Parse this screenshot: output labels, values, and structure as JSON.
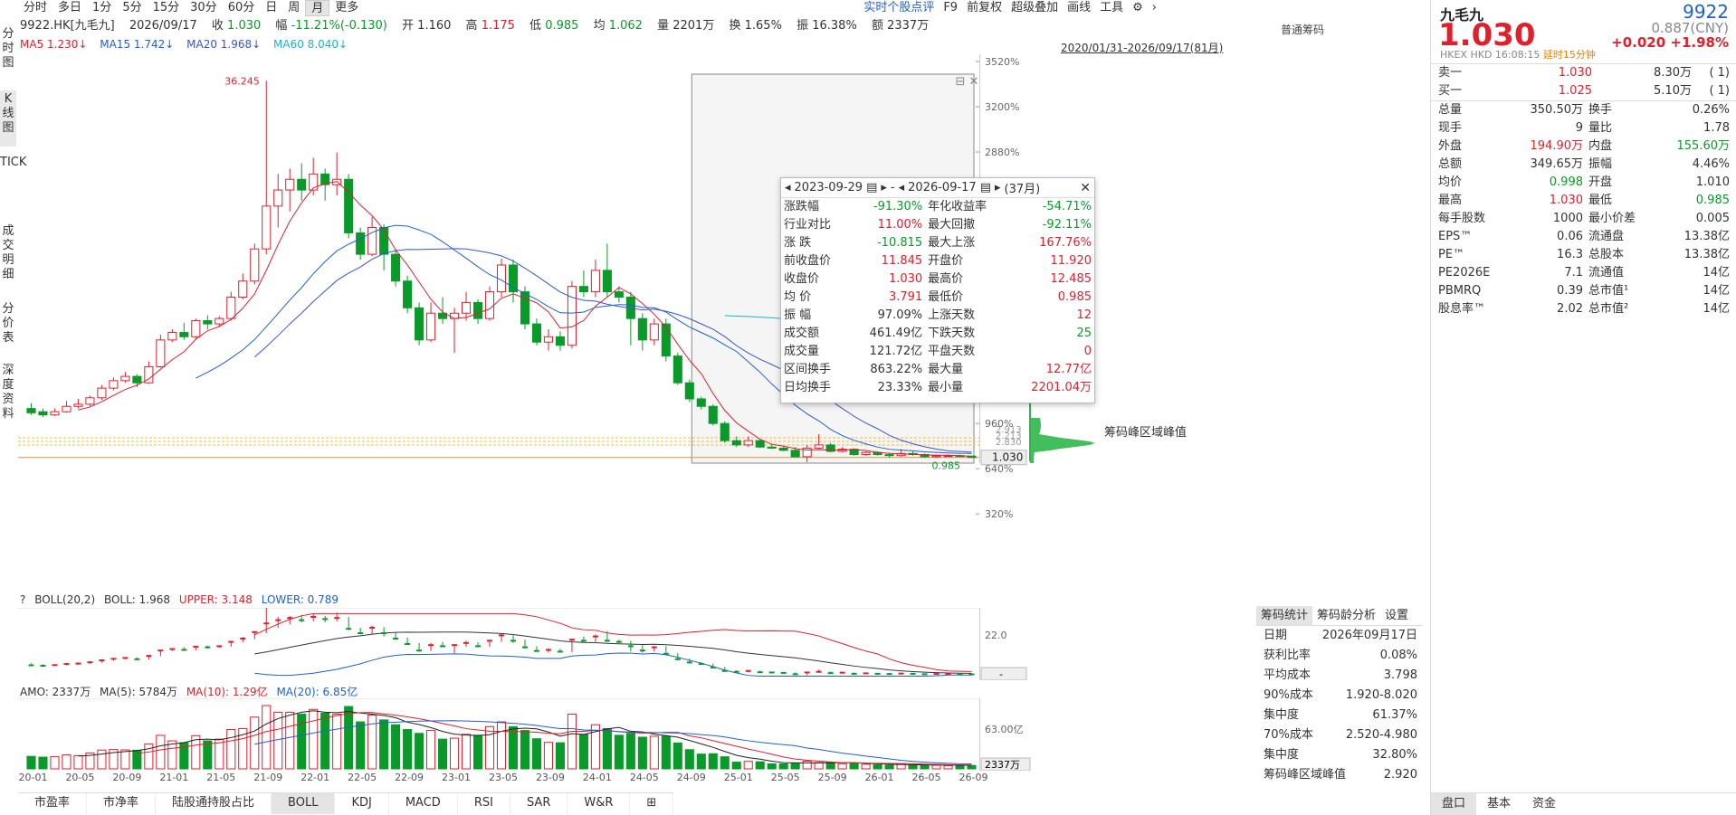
{
  "periods": [
    "分时",
    "多日",
    "1分",
    "5分",
    "15分",
    "30分",
    "60分",
    "日",
    "周",
    "月",
    "更多"
  ],
  "active_period": "月",
  "info": {
    "code": "9922.HK[九毛九]",
    "date": "2026/09/17",
    "close_label": "收",
    "close": "1.030",
    "range_label": "幅",
    "range": "-11.21%(-0.130)",
    "open_label": "开",
    "open": "1.160",
    "high_label": "高",
    "high": "1.175",
    "low_label": "低",
    "low": "0.985",
    "avg_label": "均",
    "avg": "1.062",
    "vol_label": "量",
    "vol": "2201万",
    "turn_label": "换",
    "turn": "1.65%",
    "amp_label": "振",
    "amp": "16.38%",
    "amt_label": "额",
    "amt": "2337万"
  },
  "topright": [
    "实时个股点评",
    "F9",
    "前复权",
    "超级叠加",
    "画线",
    "工具"
  ],
  "ma": {
    "ma5": "MA5 1.230↓",
    "ma15": "MA15 1.742↓",
    "ma20": "MA20 1.968↓",
    "ma60": "MA60 8.040↓"
  },
  "date_range": "2020/01/31-2026/09/17(81月)",
  "chips_title": "普通筹码",
  "sidebar": [
    "分时图",
    "K线图",
    "TICK",
    "成交明细",
    "分价表",
    "深度资料"
  ],
  "main_chart": {
    "y_ticks": [
      "3520%",
      "3200%",
      "2880%",
      "2560%",
      "2240%",
      "1920%",
      "1600%",
      "1280%",
      "960%",
      "640%",
      "320%"
    ],
    "max_label": "36.245",
    "min_label": "0.985",
    "last_price": "1.030",
    "chip_right_labels": [
      "2.913",
      "2.213",
      "2.830"
    ],
    "chip_label": "筹码峰区域峰值"
  },
  "popup": {
    "start": "2023-09-29",
    "sep": "-",
    "end": "2026-09-17",
    "months": "(37月)",
    "rows": [
      [
        "涨跌幅",
        "-91.30%",
        "年化收益率",
        "-54.71%"
      ],
      [
        "行业对比",
        "11.00%",
        "最大回撤",
        "-92.11%"
      ],
      [
        "涨 跌",
        "-10.815",
        "最大上涨",
        "167.76%"
      ],
      [
        "前收盘价",
        "11.845",
        "开盘价",
        "11.920"
      ],
      [
        "收盘价",
        "1.030",
        "最高价",
        "12.485"
      ],
      [
        "均 价",
        "3.791",
        "最低价",
        "0.985"
      ],
      [
        "振 幅",
        "97.09%",
        "上涨天数",
        "12"
      ],
      [
        "成交额",
        "461.49亿",
        "下跌天数",
        "25"
      ],
      [
        "成交量",
        "121.72亿",
        "平盘天数",
        "0"
      ],
      [
        "区间换手",
        "863.22%",
        "最大量",
        "12.77亿"
      ],
      [
        "日均换手",
        "23.33%",
        "最小量",
        "2201.04万"
      ]
    ]
  },
  "boll": {
    "q": "?",
    "name": "BOLL(20,2)",
    "mid": "BOLL: 1.968",
    "upper": "UPPER: 3.148",
    "lower": "LOWER: 0.789",
    "axis": "22.0",
    "tag": "-"
  },
  "amo": {
    "name": "AMO: 2337万",
    "ma5": "MA(5): 5784万",
    "ma10": "MA(10): 1.29亿",
    "ma20": "MA(20): 6.85亿",
    "axis": "63.00亿",
    "tag": "2337万"
  },
  "x_labels": [
    "20-01",
    "20-05",
    "20-09",
    "21-01",
    "21-05",
    "21-09",
    "22-01",
    "22-05",
    "22-09",
    "23-01",
    "23-05",
    "23-09",
    "24-01",
    "24-05",
    "24-09",
    "25-01",
    "25-05",
    "25-09",
    "26-01",
    "26-05",
    "26-09"
  ],
  "bottom_tabs": [
    "市盈率",
    "市净率",
    "陆股通持股占比",
    "BOLL",
    "KDJ",
    "MACD",
    "RSI",
    "SAR",
    "W&R",
    "⊞"
  ],
  "active_bottom_tab": "BOLL",
  "chip_tabs": [
    "筹码统计",
    "筹码龄分析",
    "设置"
  ],
  "chip_stats": [
    [
      "日期",
      "2026年09月17日"
    ],
    [
      "获利比率",
      "0.08%"
    ],
    [
      "平均成本",
      "3.798"
    ],
    [
      "90%成本",
      "1.920-8.020"
    ],
    [
      "集中度",
      "61.37%"
    ],
    [
      "70%成本",
      "2.520-4.980"
    ],
    [
      "集中度",
      "32.80%"
    ],
    [
      "筹码峰区域峰值",
      "2.920"
    ]
  ],
  "quote": {
    "name": "九毛九",
    "code": "9922",
    "price": "1.030",
    "prev": "0.887(CNY)",
    "change": "+0.020  +1.98%",
    "market": "HKEX  HKD  16:08:15",
    "delay": "延时15分钟",
    "orderbook": [
      [
        "卖一",
        "1.030",
        "8.30万",
        "( 1)"
      ],
      [
        "买一",
        "1.025",
        "5.10万",
        "( 1)"
      ]
    ],
    "stats": [
      [
        "总量",
        "350.50万",
        "换手",
        "0.26%"
      ],
      [
        "现手",
        "9",
        "量比",
        "1.78"
      ],
      [
        "外盘",
        "194.90万",
        "内盘",
        "155.60万"
      ],
      [
        "总额",
        "349.65万",
        "振幅",
        "4.46%"
      ],
      [
        "均价",
        "0.998",
        "开盘",
        "1.010"
      ],
      [
        "最高",
        "1.030",
        "最低",
        "0.985"
      ],
      [
        "每手股数",
        "1000",
        "最小价差",
        "0.005"
      ],
      [
        "EPS™",
        "0.06",
        "流通盘",
        "13.38亿"
      ],
      [
        "PE™",
        "16.3",
        "总股本",
        "13.38亿"
      ],
      [
        "PE2026E",
        "7.1",
        "流通值",
        "14亿"
      ],
      [
        "PBMRQ",
        "0.39",
        "总市值¹",
        "14亿"
      ],
      [
        "股息率™",
        "2.02",
        "总市值²",
        "14亿"
      ]
    ],
    "tabs": [
      "盘口",
      "基本",
      "资金"
    ]
  },
  "colors": {
    "up": "#e0202c",
    "down": "#0a9a2a",
    "ma5": "#e0202c",
    "ma15": "#2060d0",
    "ma20": "#3a55cc",
    "ma60": "#18b4c8"
  },
  "chart_data": {
    "type": "candlestick",
    "candles": [
      [
        5.6,
        5.2,
        6.1,
        5.0
      ],
      [
        5.3,
        5.0,
        5.6,
        4.8
      ],
      [
        5.0,
        5.3,
        5.6,
        4.9
      ],
      [
        5.3,
        5.8,
        6.3,
        5.2
      ],
      [
        5.8,
        6.0,
        6.5,
        5.6
      ],
      [
        6.0,
        6.6,
        6.8,
        5.8
      ],
      [
        6.6,
        7.5,
        7.8,
        6.4
      ],
      [
        7.5,
        8.2,
        8.5,
        7.3
      ],
      [
        8.2,
        8.6,
        9.0,
        8.0
      ],
      [
        8.6,
        8.0,
        8.8,
        7.6
      ],
      [
        8.0,
        9.5,
        10.0,
        7.9
      ],
      [
        9.5,
        12.0,
        12.5,
        9.4
      ],
      [
        12.0,
        12.7,
        13.0,
        11.8
      ],
      [
        12.7,
        12.3,
        13.6,
        12.0
      ],
      [
        12.3,
        13.8,
        14.0,
        12.1
      ],
      [
        13.8,
        13.5,
        14.3,
        13.0
      ],
      [
        13.5,
        14.0,
        14.2,
        13.2
      ],
      [
        14.0,
        16.0,
        16.5,
        13.8
      ],
      [
        16.0,
        17.5,
        18.2,
        15.8
      ],
      [
        17.5,
        20.5,
        21.0,
        17.2
      ],
      [
        20.5,
        24.5,
        36.2,
        20.0
      ],
      [
        24.5,
        26.0,
        27.5,
        22.5
      ],
      [
        26.0,
        27.0,
        28.0,
        24.0
      ],
      [
        27.0,
        26.0,
        28.5,
        25.0
      ],
      [
        26.0,
        27.5,
        29.0,
        25.5
      ],
      [
        27.5,
        26.5,
        28.0,
        25.0
      ],
      [
        26.5,
        27.0,
        29.5,
        25.5
      ],
      [
        27.0,
        22.0,
        27.5,
        21.5
      ],
      [
        22.0,
        20.0,
        22.5,
        19.5
      ],
      [
        20.0,
        22.5,
        23.5,
        19.8
      ],
      [
        22.5,
        20.0,
        22.8,
        18.5
      ],
      [
        20.0,
        17.5,
        20.5,
        17.0
      ],
      [
        17.5,
        15.0,
        18.0,
        14.5
      ],
      [
        15.0,
        12.0,
        15.5,
        11.5
      ],
      [
        12.0,
        14.5,
        15.5,
        11.8
      ],
      [
        14.5,
        14.0,
        16.0,
        13.5
      ],
      [
        14.0,
        14.5,
        15.0,
        10.8
      ],
      [
        14.5,
        15.5,
        16.5,
        13.8
      ],
      [
        15.5,
        14.0,
        15.8,
        13.5
      ],
      [
        14.0,
        16.5,
        17.0,
        13.8
      ],
      [
        16.5,
        19.0,
        19.6,
        16.0
      ],
      [
        19.0,
        16.5,
        19.5,
        15.5
      ],
      [
        16.5,
        13.5,
        17.0,
        13.0
      ],
      [
        13.5,
        11.8,
        14.0,
        11.5
      ],
      [
        11.8,
        12.3,
        13.0,
        11.0
      ],
      [
        12.3,
        11.5,
        12.8,
        11.0
      ],
      [
        11.5,
        17.0,
        17.5,
        11.2
      ],
      [
        17.0,
        16.5,
        18.5,
        16.0
      ],
      [
        16.5,
        18.5,
        19.5,
        16.0
      ],
      [
        18.5,
        16.5,
        21.0,
        16.0
      ],
      [
        16.5,
        16.0,
        17.0,
        15.5
      ],
      [
        16.0,
        14.0,
        16.5,
        11.5
      ],
      [
        14.0,
        12.0,
        14.5,
        11.0
      ],
      [
        12.0,
        13.5,
        14.0,
        11.5
      ],
      [
        13.5,
        10.5,
        14.0,
        10.0
      ],
      [
        10.5,
        8.0,
        10.8,
        7.8
      ],
      [
        8.0,
        6.5,
        8.3,
        6.2
      ],
      [
        6.5,
        5.8,
        6.7,
        5.5
      ],
      [
        5.8,
        4.2,
        6.0,
        4.0
      ],
      [
        4.2,
        2.6,
        4.4,
        2.4
      ],
      [
        2.6,
        2.2,
        3.0,
        2.0
      ],
      [
        2.2,
        2.6,
        3.0,
        2.0
      ],
      [
        2.6,
        2.0,
        2.8,
        1.9
      ],
      [
        2.0,
        1.9,
        2.3,
        1.8
      ],
      [
        1.9,
        1.7,
        2.1,
        1.6
      ],
      [
        1.7,
        1.1,
        2.0,
        1.0
      ],
      [
        1.1,
        1.9,
        2.2,
        0.6
      ],
      [
        1.9,
        2.2,
        3.2,
        1.8
      ],
      [
        2.2,
        1.6,
        2.4,
        1.5
      ],
      [
        1.6,
        1.8,
        2.0,
        1.5
      ],
      [
        1.8,
        1.3,
        1.9,
        1.2
      ],
      [
        1.3,
        1.5,
        1.6,
        1.2
      ],
      [
        1.5,
        1.3,
        1.6,
        1.2
      ],
      [
        1.3,
        1.2,
        1.4,
        1.0
      ],
      [
        1.2,
        1.4,
        1.8,
        1.1
      ],
      [
        1.4,
        1.3,
        1.6,
        1.2
      ],
      [
        1.3,
        1.1,
        1.4,
        1.0
      ],
      [
        1.1,
        1.2,
        1.3,
        1.0
      ],
      [
        1.2,
        1.2,
        1.3,
        1.1
      ],
      [
        1.2,
        1.16,
        1.3,
        1.1
      ],
      [
        1.16,
        1.03,
        1.175,
        0.985
      ]
    ]
  }
}
